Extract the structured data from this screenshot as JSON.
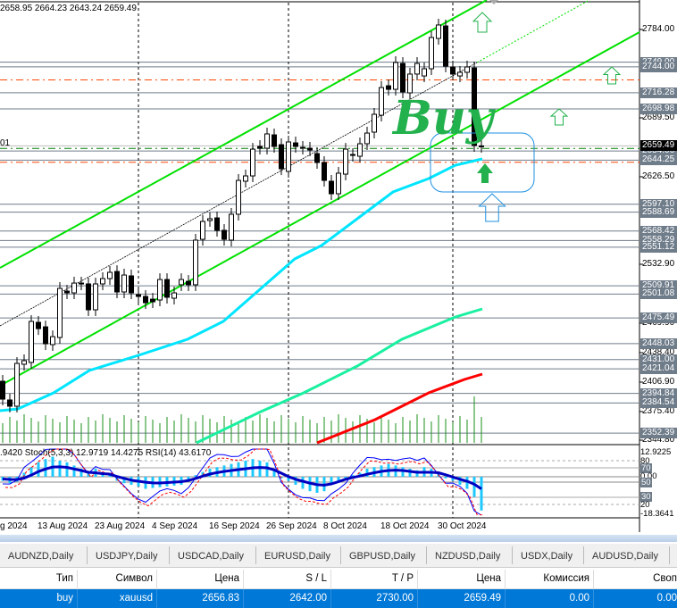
{
  "header": {
    "ohlc": "2658.95 2664.23 2643.24 2659.49",
    "cut_label": "01"
  },
  "chart_data": {
    "type": "candlestick",
    "symbol_timeframe": "Daily",
    "candles": [
      [
        2407.8,
        2388.7
      ],
      [
        2387.8,
        2381.1
      ],
      [
        2381.1,
        2426.9
      ],
      [
        2426.0,
        2429.8
      ],
      [
        2427.9,
        2471.8
      ],
      [
        2470.8,
        2464.1
      ],
      [
        2466.0,
        2447.9
      ],
      [
        2447.0,
        2455.5
      ],
      [
        2454.6,
        2507.1
      ],
      [
        2504.2,
        2502.3
      ],
      [
        2502.3,
        2512.8
      ],
      [
        2512.8,
        2511.9
      ],
      [
        2511.9,
        2484.2
      ],
      [
        2484.2,
        2511.9
      ],
      [
        2511.9,
        2517.6
      ],
      [
        2517.6,
        2524.3
      ],
      [
        2525.2,
        2503.3
      ],
      [
        2503.3,
        2521.4
      ],
      [
        2520.5,
        2502.3
      ],
      [
        2500.4,
        2498.5
      ],
      [
        2498.5,
        2491.8
      ],
      [
        2495.6,
        2492.8
      ],
      [
        2494.7,
        2516.6
      ],
      [
        2516.6,
        2497.6
      ],
      [
        2496.6,
        2502.3
      ],
      [
        2511.0,
        2516.6
      ],
      [
        2514.7,
        2511.0
      ],
      [
        2511.0,
        2558.7
      ],
      [
        2559.6,
        2578.7
      ],
      [
        2579.7,
        2581.6
      ],
      [
        2582.5,
        2569.2
      ],
      [
        2569.2,
        2559.6
      ],
      [
        2558.7,
        2586.4
      ],
      [
        2586.4,
        2622.6
      ],
      [
        2621.7,
        2627.4
      ],
      [
        2627.4,
        2656.0
      ],
      [
        2658.9,
        2657.0
      ],
      [
        2657.0,
        2672.3
      ],
      [
        2671.3,
        2658.9
      ],
      [
        2660.8,
        2635.0
      ],
      [
        2632.2,
        2663.7
      ],
      [
        2662.7,
        2658.9
      ],
      [
        2658.0,
        2657.0
      ],
      [
        2657.0,
        2655.1
      ],
      [
        2651.3,
        2641.7
      ],
      [
        2641.7,
        2622.6
      ],
      [
        2621.7,
        2608.3
      ],
      [
        2608.3,
        2630.3
      ],
      [
        2629.3,
        2656.0
      ],
      [
        2650.3,
        2649.4
      ],
      [
        2648.4,
        2661.8
      ],
      [
        2661.8,
        2673.2
      ],
      [
        2674.2,
        2693.3
      ],
      [
        2692.3,
        2721.9
      ],
      [
        2723.8,
        2720.0
      ],
      [
        2720.0,
        2748.7
      ],
      [
        2747.7,
        2717.2
      ],
      [
        2716.2,
        2736.3
      ],
      [
        2736.3,
        2747.7
      ],
      [
        2734.3,
        2742.0
      ],
      [
        2742.0,
        2775.4
      ],
      [
        2774.4,
        2788.8
      ],
      [
        2787.8,
        2744.8
      ],
      [
        2743.9,
        2736.3
      ],
      [
        2734.3,
        2738.2
      ],
      [
        2738.2,
        2743.9
      ],
      [
        2742.9,
        2659.9
      ],
      [
        2658.95,
        2659.49
      ]
    ],
    "last": {
      "open": 2658.95,
      "high": 2664.23,
      "low": 2643.24,
      "close": 2659.49
    },
    "ylim": [
      2344.8,
      2784.0
    ],
    "y_ticks": [
      "2784.00",
      "2689.50",
      "2626.50",
      "2532.90",
      "2469.90",
      "2438.40",
      "2406.90",
      "2375.40",
      "2344.80"
    ],
    "levels": [
      "2749.00",
      "2744.00",
      "2716.28",
      "2698.98",
      "2654.06",
      "2644.25",
      "2597.10",
      "2588.69",
      "2568.42",
      "2558.29",
      "2551.12",
      "2509.91",
      "2501.08",
      "2475.49",
      "2448.03",
      "2431.00",
      "2421.04",
      "2394.84",
      "2384.54",
      "2352.39"
    ],
    "current_price": "2659.49",
    "entry": 2656.83,
    "stop_loss": 2642.0,
    "take_profit": 2730.0,
    "signal_text": "Buy",
    "x_labels": [
      "g 2024",
      "13 Aug 2024",
      "23 Aug 2024",
      "4 Sep 2024",
      "16 Sep 2024",
      "26 Sep 2024",
      "8 Oct 2024",
      "18 Oct 2024",
      "30 Oct 2024"
    ],
    "indicator": {
      "text": ".9420  Stoch(5,3,3) 12.9719 14.4275  RSI(14) 43.6170",
      "labels": [
        "12.9225",
        "80",
        "70",
        "0.00",
        "50",
        "30",
        "20",
        "-18.3641"
      ]
    },
    "colors": {
      "up_channel": "#00e000",
      "ma_fast": "#00e5ff",
      "ma_mid": "#19f0a0",
      "ma_slow": "#ff0000",
      "level": "#6f7c8a",
      "sl_tp": "#ff4500",
      "entry": "#008000",
      "signal": "#22b14c",
      "selection": "#0078d7"
    }
  },
  "tabs": [
    "AUDNZD,Daily",
    "USDJPY,Daily",
    "USDCAD,Daily",
    "EURUSD,Daily",
    "GBPUSD,Daily",
    "NZDUSD,Daily",
    "USDX,Daily",
    "AUDUSD,Daily"
  ],
  "orders": {
    "columns": [
      "Тип",
      "Символ",
      "Цена",
      "S / L",
      "T / P",
      "Цена",
      "Комиссия",
      "Своп"
    ],
    "rows": [
      [
        "buy",
        "xauusd",
        "2656.83",
        "2642.00",
        "2730.00",
        "2659.49",
        "0.00",
        "0.00"
      ]
    ]
  }
}
